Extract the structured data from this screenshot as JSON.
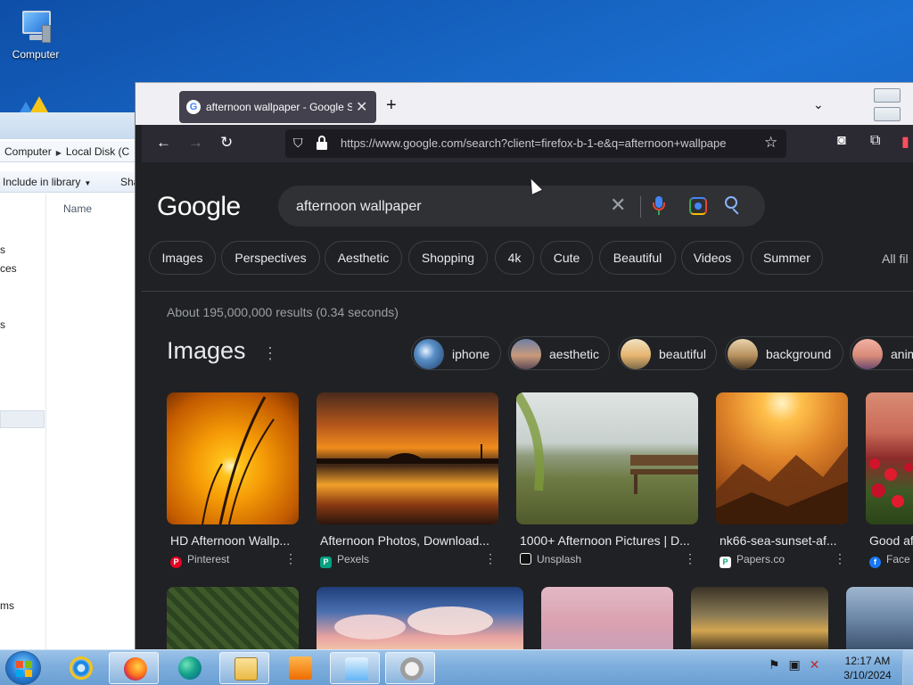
{
  "desktop": {
    "computer_icon_label": "Computer"
  },
  "explorer": {
    "breadcrumb": [
      "Computer",
      "Local Disk (C"
    ],
    "toolbar": {
      "include_label": "Include in library",
      "share_label": "Sha"
    },
    "column_name": "Name",
    "nav_fragments": [
      "s",
      "ces",
      "s"
    ],
    "status_fragment": "ms"
  },
  "browser": {
    "tab_title": "afternoon wallpaper - Google S",
    "url": "https://www.google.com/search?client=firefox-b-1-e&q=afternoon+wallpape",
    "url_host": "google.com"
  },
  "google": {
    "logo": "Google",
    "query": "afternoon wallpaper",
    "chips": [
      "Images",
      "Perspectives",
      "Aesthetic",
      "Shopping",
      "4k",
      "Cute",
      "Beautiful",
      "Videos",
      "Summer"
    ],
    "all_filters": "All fil",
    "results_count": "About 195,000,000 results (0.34 seconds)",
    "images_heading": "Images",
    "refinements": [
      "iphone",
      "aesthetic",
      "beautiful",
      "background",
      "anim"
    ],
    "image_results": [
      {
        "title": "HD Afternoon Wallp...",
        "source": "Pinterest",
        "favicon": "pinterest-icon",
        "color": "#e60023"
      },
      {
        "title": "Afternoon Photos, Download...",
        "source": "Pexels",
        "favicon": "pexels-icon",
        "color": "#05a081"
      },
      {
        "title": "1000+ Afternoon Pictures | D...",
        "source": "Unsplash",
        "favicon": "unsplash-icon",
        "color": "#111111"
      },
      {
        "title": "nk66-sea-sunset-af...",
        "source": "Papers.co",
        "favicon": "papers-icon",
        "color": "#ffffff"
      },
      {
        "title": "Good af",
        "source": "Face",
        "favicon": "facebook-icon",
        "color": "#1877f2"
      }
    ]
  },
  "taskbar": {
    "time": "12:17 AM",
    "date": "3/10/2024",
    "apps": [
      "internet-explorer",
      "firefox",
      "edge",
      "file-explorer",
      "media-player",
      "control-panel",
      "volume-mixer"
    ]
  }
}
